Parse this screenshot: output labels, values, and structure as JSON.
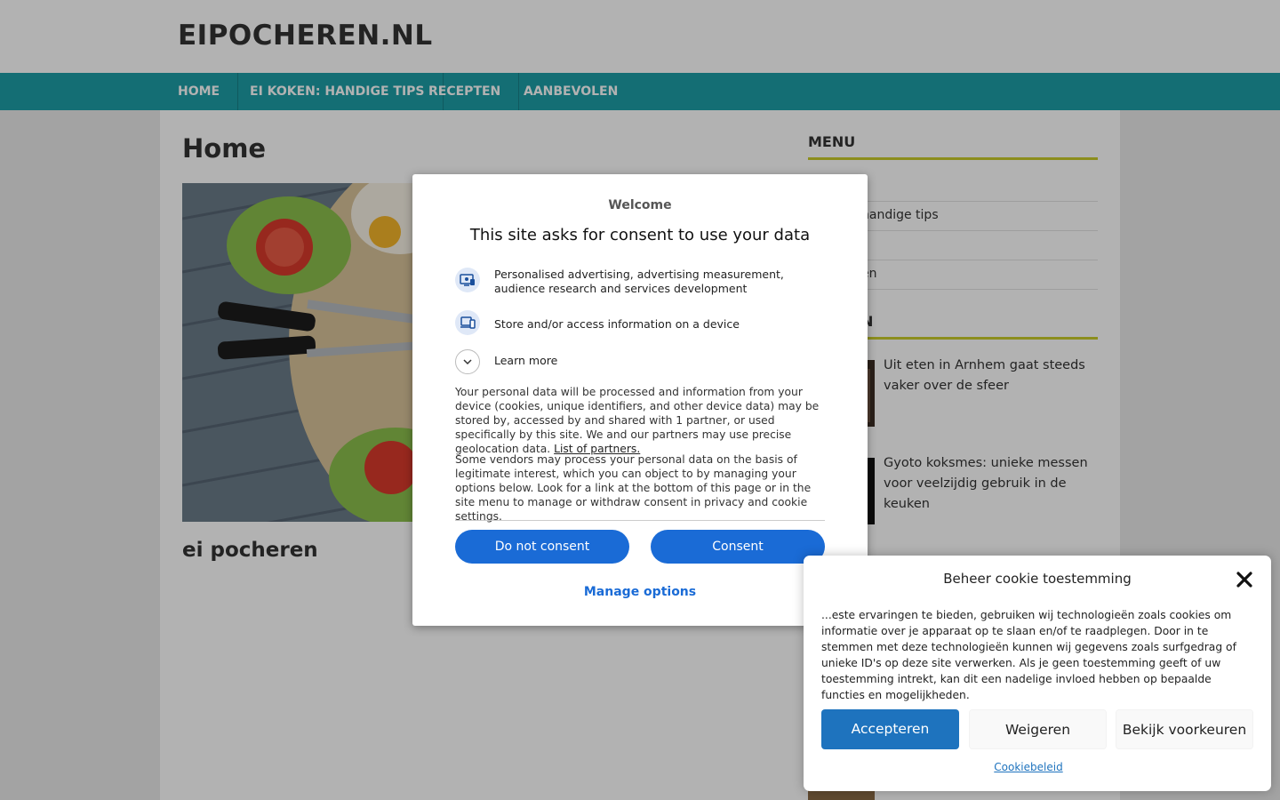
{
  "site": {
    "title": "EIPOCHEREN.NL",
    "nav": [
      "HOME",
      "EI KOKEN: HANDIGE TIPS",
      "RECEPTEN",
      "AANBEVOLEN"
    ],
    "accent": "#1e9ea6"
  },
  "main": {
    "page_title": "Home",
    "featured_image": "eggs-tomato-lettuce-knives-photo",
    "post_title": "ei pocheren"
  },
  "sidebar": {
    "menu_title": "MENU",
    "menu_items": [
      "handige tips",
      "en"
    ],
    "recent_title": "N",
    "posts": [
      {
        "title": "Uit eten in Arnhem gaat steeds vaker over de sfeer"
      },
      {
        "title": "Gyoto koksmes: unieke messen voor veelzijdig gebruik in de keuken"
      }
    ]
  },
  "consent_dialog": {
    "welcome": "Welcome",
    "heading": "This site asks for consent to use your data",
    "purposes": [
      {
        "icon": "personalised-ads-icon",
        "label": "Personalised advertising, advertising measurement, audience research and services development"
      },
      {
        "icon": "device-storage-icon",
        "label": "Store and/or access information on a device"
      }
    ],
    "learn_more": "Learn more",
    "paragraph1": "Your personal data will be processed and information from your device (cookies, unique identifiers, and other device data) may be stored by, accessed by and shared with 1 partner, or used specifically by this site. We and our partners may use precise geolocation data.",
    "partners_link": "List of partners.",
    "paragraph2": "Some vendors may process your personal data on the basis of legitimate interest, which you can object to by managing your options below. Look for a link at the bottom of this page or in the site menu to manage or withdraw consent in privacy and cookie settings.",
    "do_not_consent": "Do not consent",
    "consent": "Consent",
    "manage_options": "Manage options",
    "button_color": "#1a6bd6"
  },
  "cookie_popup": {
    "title": "Beheer cookie toestemming",
    "text": "...este ervaringen te bieden, gebruiken wij technologieën zoals cookies om informatie over je apparaat op te slaan en/of te raadplegen. Door in te stemmen met deze technologieën kunnen wij gegevens zoals surfgedrag of unieke ID's op deze site verwerken. Als je geen toestemming geeft of uw toestemming intrekt, kan dit een nadelige invloed hebben op bepaalde functies en mogelijkheden.",
    "accept": "Accepteren",
    "refuse": "Weigeren",
    "preferences": "Bekijk voorkeuren",
    "policy": "Cookiebeleid",
    "accent": "#1e73be"
  }
}
